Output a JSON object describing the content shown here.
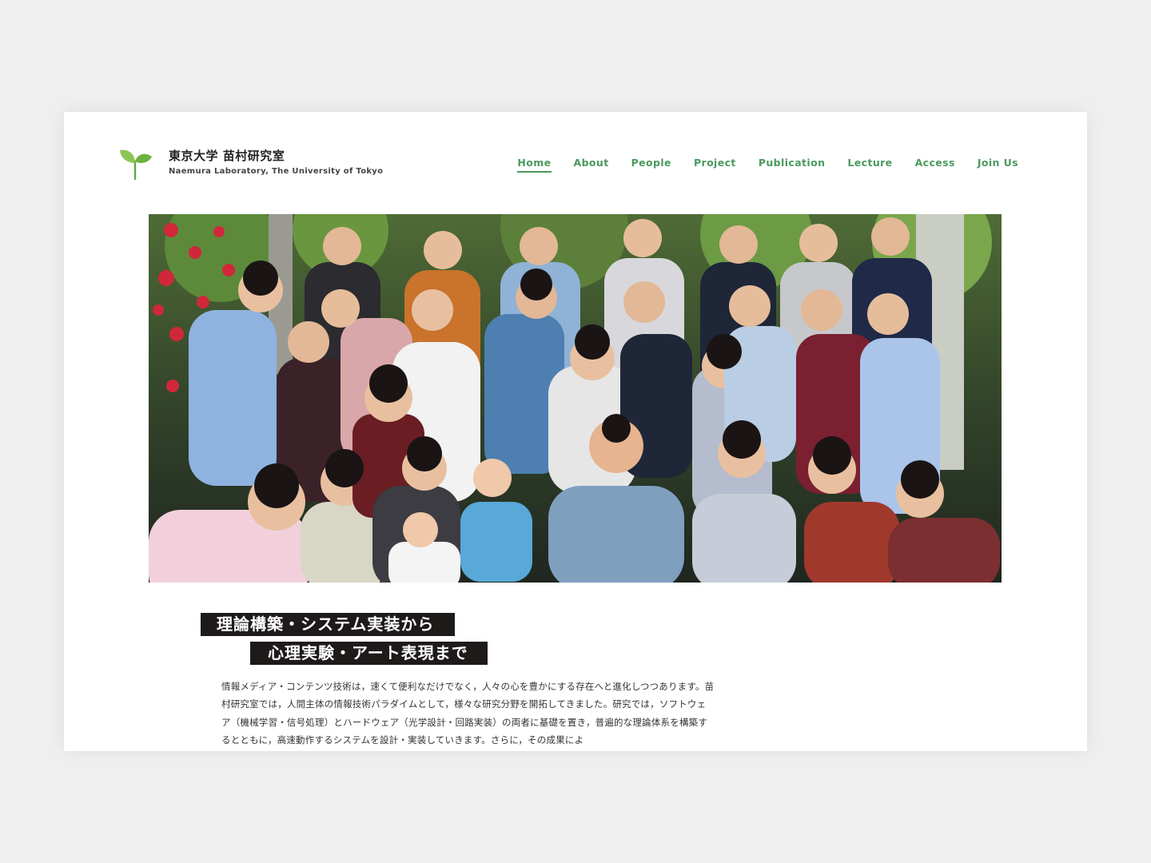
{
  "header": {
    "lab_name_ja": "東京大学 苗村研究室",
    "lab_name_en": "Naemura Laboratory, The University of Tokyo",
    "logo_icon": "sprout-icon",
    "accent_color": "#4a9a5e"
  },
  "nav": {
    "items": [
      {
        "label": "Home",
        "active": true
      },
      {
        "label": "About"
      },
      {
        "label": "People"
      },
      {
        "label": "Project"
      },
      {
        "label": "Publication"
      },
      {
        "label": "Lecture"
      },
      {
        "label": "Access"
      },
      {
        "label": "Join Us"
      }
    ]
  },
  "hero": {
    "image": "lab-group-photo"
  },
  "intro": {
    "headline_line1": "理論構築・システム実装から",
    "headline_line2": "心理実験・アート表現まで",
    "body": "情報メディア・コンテンツ技術は，速くて便利なだけでなく，人々の心を豊かにする存在へと進化しつつあります。苗村研究室では，人間主体の情報技術パラダイムとして，様々な研究分野を開拓してきました。研究では，ソフトウェア（機械学習・信号処理）とハードウェア（光学設計・回路実装）の両者に基礎を置き，普遍的な理論体系を構築するとともに，高速動作するシステムを設計・実装していきます。さらに，その成果によ"
  }
}
